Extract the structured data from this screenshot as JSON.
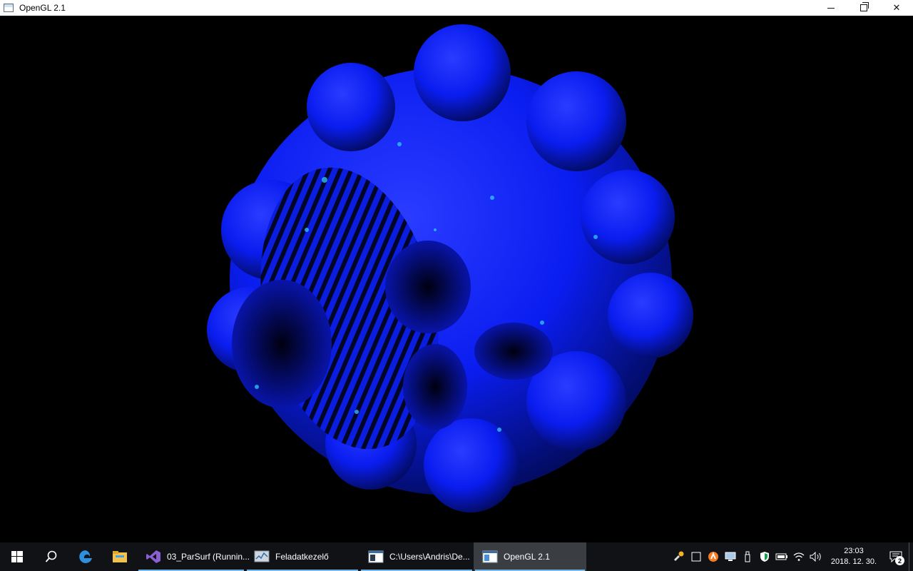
{
  "window": {
    "title": "OpenGL 2.1",
    "icon": "opengl-window-icon"
  },
  "scene": {
    "description_color": "#0a1fff",
    "highlight_color": "#33c8ff",
    "background": "#000000"
  },
  "taskbar": {
    "start": "windows-start-icon",
    "search": "search-icon",
    "pinned": [
      "edge-icon",
      "file-explorer-icon"
    ],
    "apps": [
      {
        "label": "03_ParSurf (Runnin...",
        "icon": "visual-studio-icon",
        "active": false
      },
      {
        "label": "Feladatkezelő",
        "icon": "task-manager-icon",
        "active": false
      },
      {
        "label": "C:\\Users\\Andris\\De...",
        "icon": "console-icon",
        "active": false
      },
      {
        "label": "OpenGL 2.1",
        "icon": "opengl-window-icon",
        "active": true
      }
    ],
    "clock": {
      "time": "23:03",
      "date": "2018. 12. 30."
    },
    "notifications_count": "2"
  }
}
